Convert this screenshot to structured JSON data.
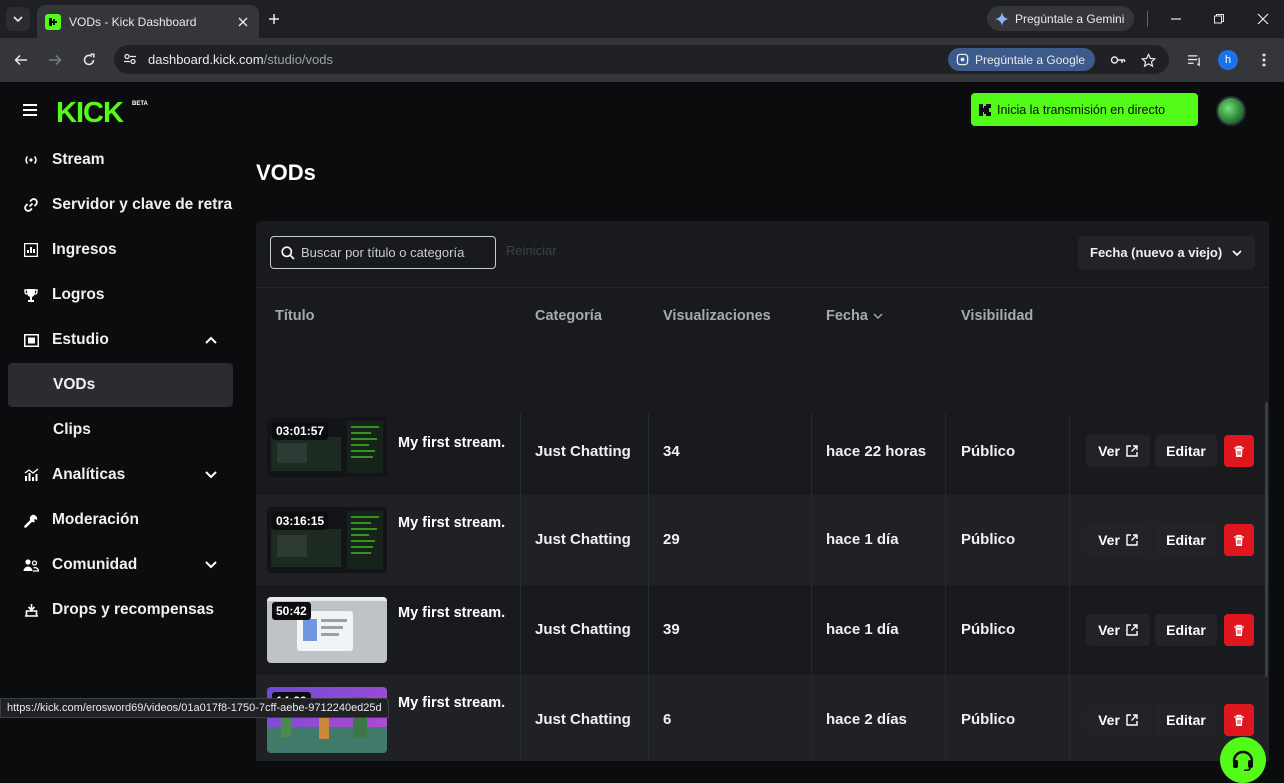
{
  "browser": {
    "tab_title": "VODs - Kick Dashboard",
    "gemini_label": "Pregúntale a Gemini",
    "url_host": "dashboard.kick.com",
    "url_path": "/studio/vods",
    "ask_google_label": "Pregúntale a Google",
    "profile_initial": "h",
    "status_url": "https://kick.com/erosword69/videos/01a017f8-1750-7cff-aebe-9712240ed25d"
  },
  "header": {
    "logo_text": "KICK",
    "logo_badge": "BETA",
    "live_button_label": "Inicia la transmisión en directo"
  },
  "sidebar": {
    "items": [
      {
        "label": "Stream",
        "icon": "broadcast-icon"
      },
      {
        "label": "Servidor y clave de retransmisión",
        "icon": "link-icon"
      },
      {
        "label": "Ingresos",
        "icon": "chart-icon"
      },
      {
        "label": "Logros",
        "icon": "trophy-icon"
      },
      {
        "label": "Estudio",
        "icon": "film-icon"
      },
      {
        "label": "VODs"
      },
      {
        "label": "Clips"
      },
      {
        "label": "Analíticas",
        "icon": "analytics-icon"
      },
      {
        "label": "Moderación",
        "icon": "wrench-icon"
      },
      {
        "label": "Comunidad",
        "icon": "people-icon"
      },
      {
        "label": "Drops y recompensas",
        "icon": "gift-icon"
      }
    ]
  },
  "page": {
    "title": "VODs",
    "search_placeholder": "Buscar por título o categoría",
    "reset_label": "Reiniciar",
    "sort_label": "Fecha (nuevo a viejo)"
  },
  "table": {
    "headers": {
      "title": "Título",
      "category": "Categoría",
      "views": "Visualizaciones",
      "date": "Fecha",
      "visibility": "Visibilidad"
    },
    "view_label": "Ver",
    "edit_label": "Editar",
    "rows": [
      {
        "duration": "03:01:57",
        "title": "My first stream.",
        "category": "Just Chatting",
        "views": "34",
        "date": "hace 22 horas",
        "visibility": "Público"
      },
      {
        "duration": "03:16:15",
        "title": "My first stream.",
        "category": "Just Chatting",
        "views": "29",
        "date": "hace 1 día",
        "visibility": "Público"
      },
      {
        "duration": "50:42",
        "title": "My first stream.",
        "category": "Just Chatting",
        "views": "39",
        "date": "hace 1 día",
        "visibility": "Público"
      },
      {
        "duration": "14:29",
        "title": "My first stream.",
        "category": "Just Chatting",
        "views": "6",
        "date": "hace 2 días",
        "visibility": "Público"
      }
    ]
  },
  "colors": {
    "brand_green": "#53fc18",
    "delete_red": "#e0161e"
  }
}
